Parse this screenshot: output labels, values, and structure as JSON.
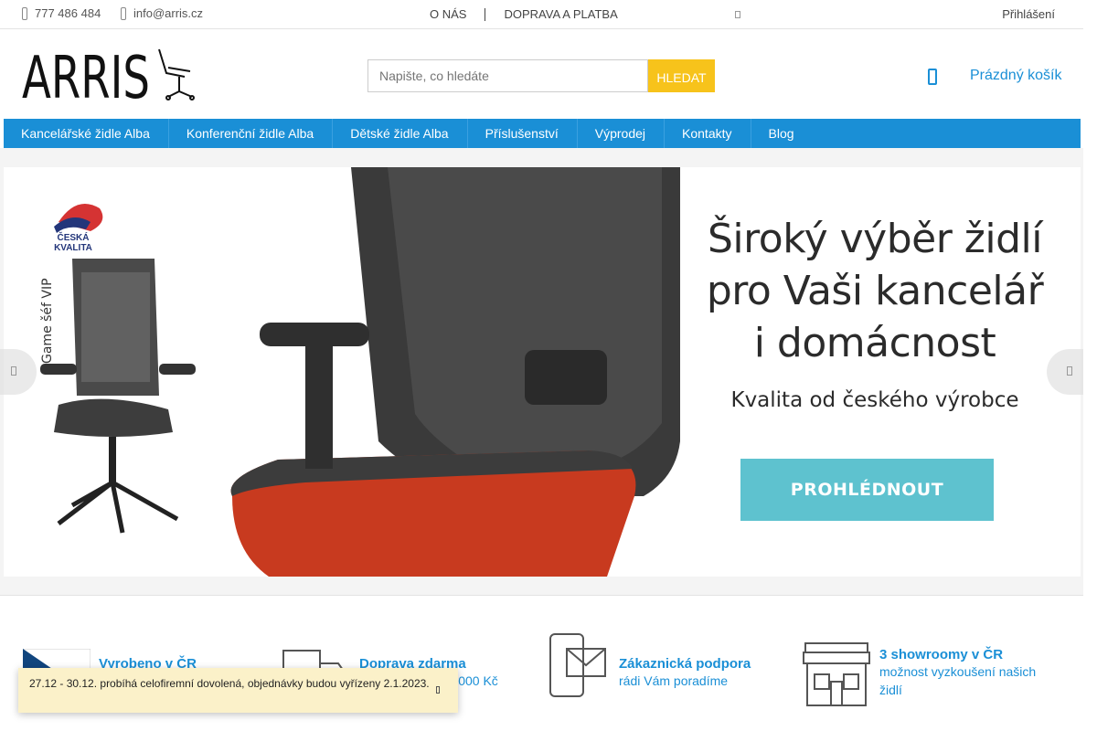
{
  "topbar": {
    "phone": "777 486 484",
    "email": "info@arris.cz",
    "links": [
      "O NÁS",
      "DOPRAVA A PLATBA"
    ],
    "login": "Přihlášení"
  },
  "header": {
    "logo_text": "ARRIS",
    "search_placeholder": "Napište, co hledáte",
    "search_button": "HLEDAT",
    "cart_label": "Prázdný košík"
  },
  "nav": [
    "Kancelářské židle Alba",
    "Konferenční židle Alba",
    "Dětské židle Alba",
    "Příslušenství",
    "Výprodej",
    "Kontakty",
    "Blog"
  ],
  "banner": {
    "headline_1": "Široký výběr židlí",
    "headline_2": "pro Vaši kancelář",
    "headline_3": "i domácnost",
    "subline": "Kvalita od českého výrobce",
    "cta": "PROHLÉDNOUT",
    "quality_badge_1": "ČESKÁ",
    "quality_badge_2": "KVALITA",
    "vertical_label": "Game šéf VIP"
  },
  "features": [
    {
      "title": "Vyrobeno v ČR",
      "sub": ""
    },
    {
      "title": "Doprava zdarma",
      "sub": "při nákupu nad 3 000 Kč"
    },
    {
      "title": "Zákaznická podpora",
      "sub": "rádi Vám poradíme"
    },
    {
      "title": "3 showroomy v ČR",
      "sub": "možnost vyzkoušení našich židlí"
    }
  ],
  "notice": "27.12 - 30.12. probíhá celofiremní dovolená, objednávky budou vyřízeny 2.1.2023.",
  "colors": {
    "primary": "#1a8fd6",
    "search_button": "#f7c31b",
    "cta": "#5ec2cf",
    "notice_bg": "#fbf1c9"
  }
}
